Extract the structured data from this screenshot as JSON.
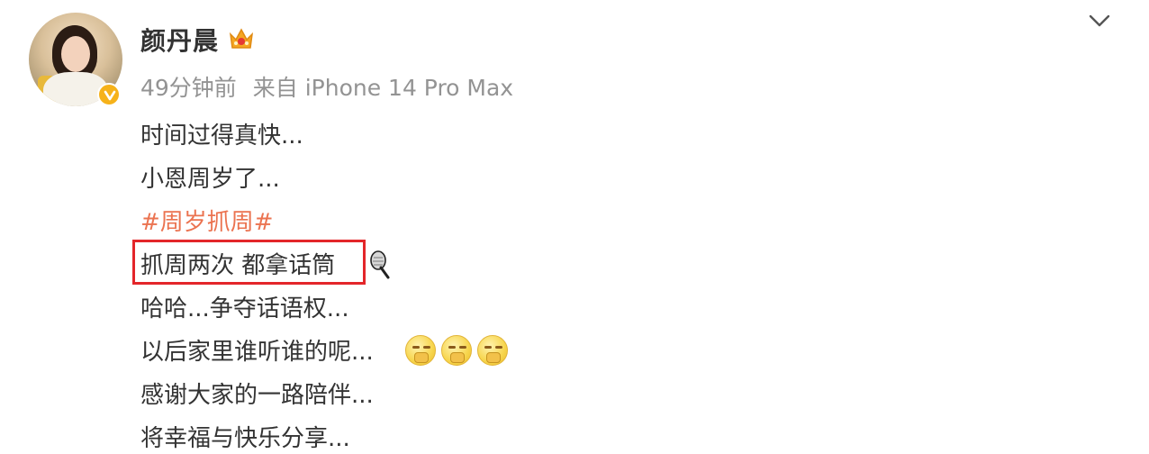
{
  "user": {
    "name": "颜丹晨",
    "time": "49分钟前",
    "source": "来自 iPhone 14 Pro Max"
  },
  "content": {
    "lines": [
      "时间过得真快...",
      "小恩周岁了...",
      "#周岁抓周#",
      "抓周两次 都拿话筒",
      "哈哈...争夺话语权...",
      "以后家里谁听谁的呢...",
      "感谢大家的一路陪伴...",
      "将幸福与快乐分享..."
    ]
  },
  "icons": {
    "avatar": "user-avatar",
    "verified": "verified-badge-icon",
    "crown": "crown-icon",
    "more": "chevron-down-icon",
    "mic": "microphone-emoji-icon",
    "thinking": "thinking-emoji-icon"
  },
  "colors": {
    "hashtag": "#eb7350",
    "meta": "#939393",
    "highlight_box": "#e3262a",
    "verified": "#f6b21a"
  }
}
